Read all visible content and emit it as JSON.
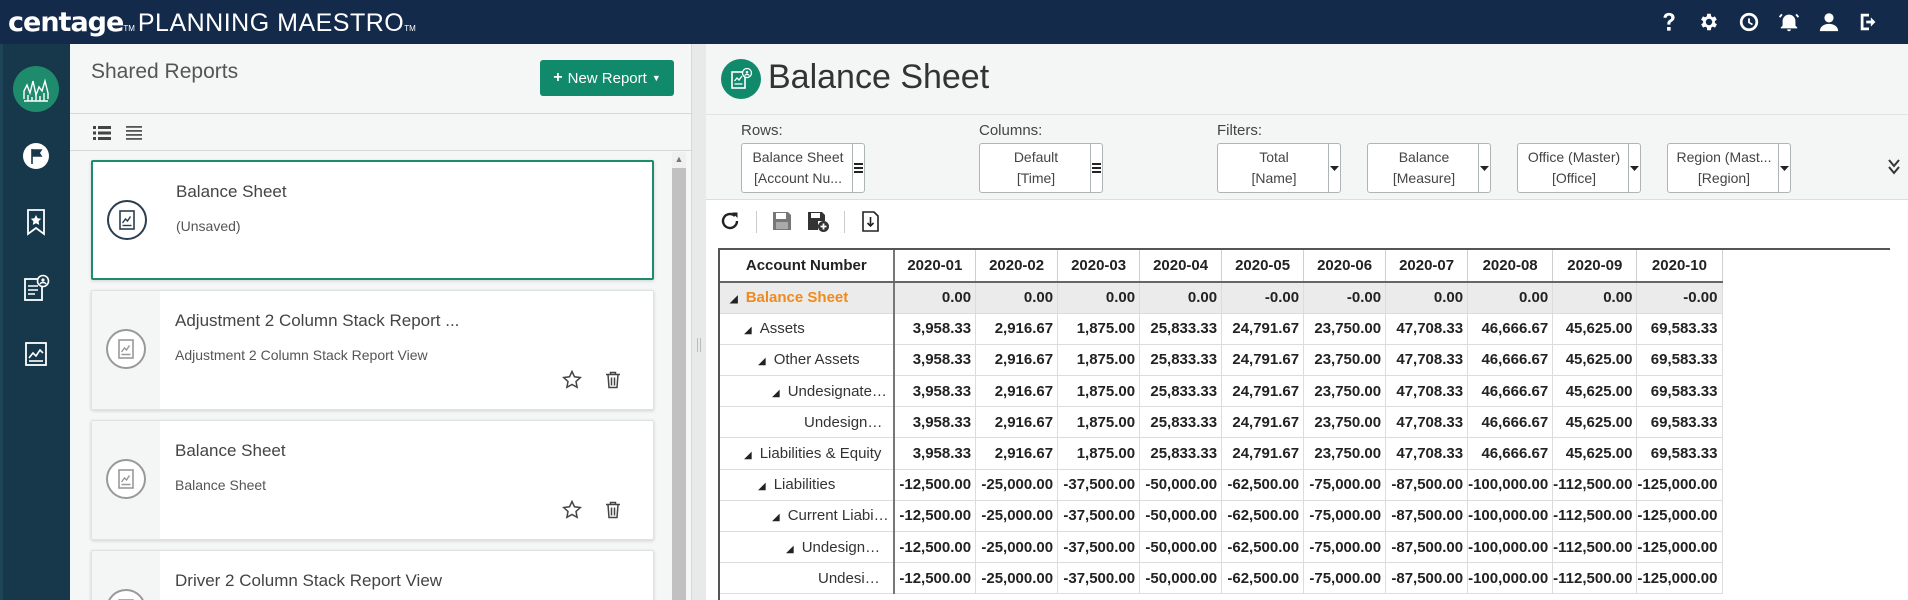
{
  "app": {
    "logo_text": "centage",
    "product_name": "PLANNING MAESTRO",
    "tm": "TM",
    "colors": {
      "topbar": "#142a4b",
      "rail": "#16384a",
      "accent": "#108a6a",
      "root_row_text": "#f08a1c"
    }
  },
  "top_icons": [
    "help-icon",
    "gear-icon",
    "clock-icon",
    "alarm-icon",
    "user-icon",
    "logout-icon"
  ],
  "rail": {
    "items": [
      "avatar-chart-icon",
      "flag-icon",
      "bookmark-star-icon",
      "report-user-icon",
      "report-chart-icon"
    ]
  },
  "reports_panel": {
    "title": "Shared Reports",
    "new_report_label": "New Report",
    "view_modes": [
      "detail-list-icon",
      "compact-list-icon"
    ],
    "cards": [
      {
        "title": "Balance Sheet",
        "subtitle": "(Unsaved)",
        "active": true
      },
      {
        "title": "Adjustment 2 Column Stack Report ...",
        "subtitle": "Adjustment 2 Column Stack Report View",
        "active": false
      },
      {
        "title": "Balance Sheet",
        "subtitle": "Balance Sheet",
        "active": false
      },
      {
        "title": "Driver 2 Column Stack Report View",
        "subtitle": "",
        "active": false
      }
    ]
  },
  "report": {
    "title": "Balance Sheet",
    "rows_label": "Rows:",
    "columns_label": "Columns:",
    "filters_label": "Filters:",
    "rows": {
      "line1": "Balance Sheet",
      "line2": "[Account Nu..."
    },
    "columns": {
      "line1": "Default",
      "line2": "[Time]"
    },
    "filters": [
      {
        "line1": "Total",
        "line2": "[Name]"
      },
      {
        "line1": "Balance",
        "line2": "[Measure]"
      },
      {
        "line1": "Office (Master)",
        "line2": "[Office]"
      },
      {
        "line1": "Region (Mast...",
        "line2": "[Region]"
      }
    ],
    "toolbar": [
      "refresh-icon",
      "save-icon",
      "save-as-icon",
      "export-icon"
    ]
  },
  "grid": {
    "account_header": "Account Number",
    "columns": [
      "2020-01",
      "2020-02",
      "2020-03",
      "2020-04",
      "2020-05",
      "2020-06",
      "2020-07",
      "2020-08",
      "2020-09",
      "2020-10"
    ],
    "rows": [
      {
        "label": "Balance Sheet",
        "level": 0,
        "expanded": true,
        "values": [
          "0.00",
          "0.00",
          "0.00",
          "0.00",
          "-0.00",
          "-0.00",
          "0.00",
          "0.00",
          "0.00",
          "-0.00"
        ]
      },
      {
        "label": "Assets",
        "level": 1,
        "expanded": true,
        "values": [
          "3,958.33",
          "2,916.67",
          "1,875.00",
          "25,833.33",
          "24,791.67",
          "23,750.00",
          "47,708.33",
          "46,666.67",
          "45,625.00",
          "69,583.33"
        ]
      },
      {
        "label": "Other Assets",
        "level": 2,
        "expanded": true,
        "values": [
          "3,958.33",
          "2,916.67",
          "1,875.00",
          "25,833.33",
          "24,791.67",
          "23,750.00",
          "47,708.33",
          "46,666.67",
          "45,625.00",
          "69,583.33"
        ]
      },
      {
        "label": "Undesignate…",
        "level": 3,
        "expanded": true,
        "values": [
          "3,958.33",
          "2,916.67",
          "1,875.00",
          "25,833.33",
          "24,791.67",
          "23,750.00",
          "47,708.33",
          "46,666.67",
          "45,625.00",
          "69,583.33"
        ]
      },
      {
        "label": "Undesign…",
        "level": 4,
        "expanded": null,
        "values": [
          "3,958.33",
          "2,916.67",
          "1,875.00",
          "25,833.33",
          "24,791.67",
          "23,750.00",
          "47,708.33",
          "46,666.67",
          "45,625.00",
          "69,583.33"
        ]
      },
      {
        "label": "Liabilities & Equity",
        "level": 1,
        "expanded": true,
        "values": [
          "3,958.33",
          "2,916.67",
          "1,875.00",
          "25,833.33",
          "24,791.67",
          "23,750.00",
          "47,708.33",
          "46,666.67",
          "45,625.00",
          "69,583.33"
        ]
      },
      {
        "label": "Liabilities",
        "level": 2,
        "expanded": true,
        "values": [
          "-12,500.00",
          "-25,000.00",
          "-37,500.00",
          "-50,000.00",
          "-62,500.00",
          "-75,000.00",
          "-87,500.00",
          "-100,000.00",
          "-112,500.00",
          "-125,000.00"
        ]
      },
      {
        "label": "Current Liabi…",
        "level": 3,
        "expanded": true,
        "values": [
          "-12,500.00",
          "-25,000.00",
          "-37,500.00",
          "-50,000.00",
          "-62,500.00",
          "-75,000.00",
          "-87,500.00",
          "-100,000.00",
          "-112,500.00",
          "-125,000.00"
        ]
      },
      {
        "label": "Undesign…",
        "level": 4,
        "expanded": true,
        "values": [
          "-12,500.00",
          "-25,000.00",
          "-37,500.00",
          "-50,000.00",
          "-62,500.00",
          "-75,000.00",
          "-87,500.00",
          "-100,000.00",
          "-112,500.00",
          "-125,000.00"
        ]
      },
      {
        "label": "Undesi…",
        "level": 5,
        "expanded": null,
        "values": [
          "-12,500.00",
          "-25,000.00",
          "-37,500.00",
          "-50,000.00",
          "-62,500.00",
          "-75,000.00",
          "-87,500.00",
          "-100,000.00",
          "-112,500.00",
          "-125,000.00"
        ]
      }
    ]
  }
}
